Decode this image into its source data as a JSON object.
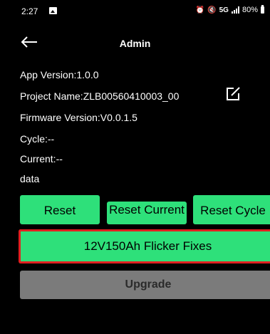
{
  "status_bar": {
    "time": "2:27",
    "network": "5G",
    "battery": "80%"
  },
  "header": {
    "title": "Admin"
  },
  "info": {
    "app_version": "App Version:1.0.0",
    "project_name": "Project Name:ZLB00560410003_00",
    "firmware_version": "Firmware Version:V0.0.1.5",
    "cycle": "Cycle:--",
    "current": "Current:--",
    "data": "data"
  },
  "buttons": {
    "reset": "Reset",
    "reset_current": "Reset Current",
    "reset_cycle": "Reset Cycle",
    "flicker_fixes": "12V150Ah Flicker Fixes",
    "upgrade": "Upgrade"
  },
  "colors": {
    "background": "#000000",
    "accent_green": "#2ee07a",
    "highlight_border": "#e02020",
    "disabled_gray": "#7b7b7b"
  }
}
